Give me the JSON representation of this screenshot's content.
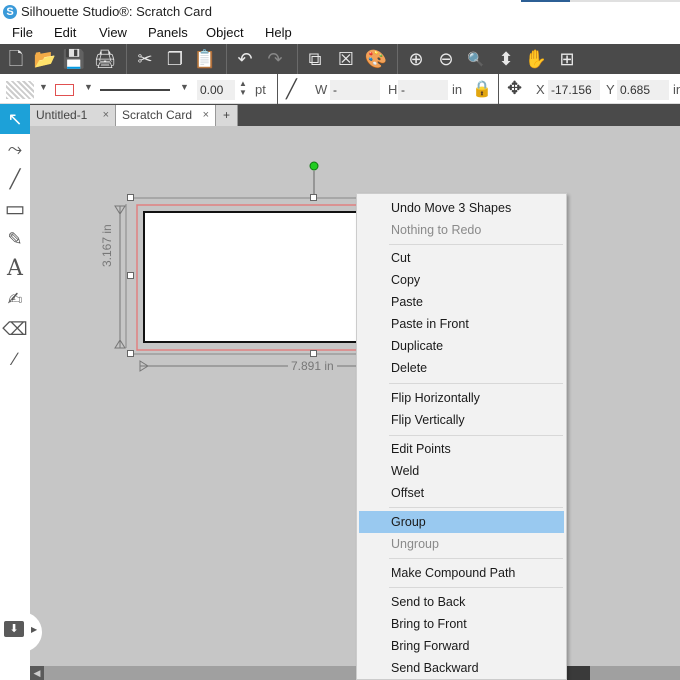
{
  "window": {
    "title": "Silhouette Studio®: Scratch Card",
    "logo_glyph": "S"
  },
  "menubar": {
    "items": [
      {
        "label": "File"
      },
      {
        "label": "Edit"
      },
      {
        "label": "View"
      },
      {
        "label": "Panels"
      },
      {
        "label": "Object"
      },
      {
        "label": "Help"
      }
    ]
  },
  "toolbar_main": {
    "icons": [
      {
        "name": "new-document-icon",
        "glyph": "🗋"
      },
      {
        "name": "open-folder-icon",
        "glyph": "📂"
      },
      {
        "name": "save-icon",
        "glyph": "💾"
      },
      {
        "name": "print-icon",
        "glyph": "🖨"
      },
      {
        "name": "cut-icon",
        "glyph": "✂"
      },
      {
        "name": "copy-icon",
        "glyph": "❐"
      },
      {
        "name": "paste-icon",
        "glyph": "📋"
      },
      {
        "name": "undo-icon",
        "glyph": "↶"
      },
      {
        "name": "redo-icon",
        "glyph": "↷"
      },
      {
        "name": "group-icon",
        "glyph": "⧉"
      },
      {
        "name": "ungroup-icon",
        "glyph": "☒"
      },
      {
        "name": "fill-color-icon",
        "glyph": "🎨"
      },
      {
        "name": "zoom-in-icon",
        "glyph": "⊕"
      },
      {
        "name": "zoom-out-icon",
        "glyph": "⊖"
      },
      {
        "name": "zoom-selection-icon",
        "glyph": "🔍"
      },
      {
        "name": "pan-drag-icon",
        "glyph": "⬍"
      },
      {
        "name": "hand-icon",
        "glyph": "✋"
      },
      {
        "name": "fit-to-page-icon",
        "glyph": "⊞"
      }
    ]
  },
  "toolbar_props": {
    "line_width_value": "0.00",
    "line_width_unit": "pt",
    "w_label": "W",
    "w_value": "-",
    "h_label": "H",
    "h_value": "-",
    "size_unit": "in",
    "x_label": "X",
    "x_value": "-17.156",
    "y_label": "Y",
    "y_value": "0.685",
    "pos_unit": "in",
    "stroke_color": "#e05050"
  },
  "tabs": [
    {
      "label": "Untitled-1",
      "close": "×",
      "active": false
    },
    {
      "label": "Scratch Card",
      "close": "×",
      "active": true
    }
  ],
  "new_tab_label": "+",
  "tools": [
    {
      "name": "select-tool-icon",
      "glyph": "↖"
    },
    {
      "name": "bezier-tool-icon",
      "glyph": "⤳"
    },
    {
      "name": "line-tool-icon",
      "glyph": "╱"
    },
    {
      "name": "rectangle-tool-icon",
      "glyph": "▭"
    },
    {
      "name": "pencil-tool-icon",
      "glyph": "✎"
    },
    {
      "name": "text-tool-icon",
      "glyph": "A"
    },
    {
      "name": "sketch-tool-icon",
      "glyph": "✍"
    },
    {
      "name": "eraser-tool-icon",
      "glyph": "⌫"
    },
    {
      "name": "knife-tool-icon",
      "glyph": "∕"
    }
  ],
  "canvas": {
    "height_dim": "3.167 in",
    "width_dim": "7.891 in",
    "rotate_handle_color": "#22cc22",
    "cut_line_color": "#e08080"
  },
  "context_menu": {
    "items": [
      {
        "label": "Undo Move 3 Shapes",
        "disabled": false
      },
      {
        "label": "Nothing to Redo",
        "disabled": true
      },
      {
        "sep": true
      },
      {
        "label": "Cut",
        "disabled": false
      },
      {
        "label": "Copy",
        "disabled": false
      },
      {
        "label": "Paste",
        "disabled": false
      },
      {
        "label": "Paste in Front",
        "disabled": false
      },
      {
        "label": "Duplicate",
        "disabled": false
      },
      {
        "label": "Delete",
        "disabled": false
      },
      {
        "sep": true
      },
      {
        "label": "Flip Horizontally",
        "disabled": false
      },
      {
        "label": "Flip Vertically",
        "disabled": false
      },
      {
        "sep": true
      },
      {
        "label": "Edit Points",
        "disabled": false
      },
      {
        "label": "Weld",
        "disabled": false
      },
      {
        "label": "Offset",
        "disabled": false
      },
      {
        "sep": true
      },
      {
        "label": "Group",
        "disabled": false,
        "highlighted": true
      },
      {
        "label": "Ungroup",
        "disabled": true
      },
      {
        "sep": true
      },
      {
        "label": "Make Compound Path",
        "disabled": false
      },
      {
        "sep": true
      },
      {
        "label": "Send to Back",
        "disabled": false
      },
      {
        "label": "Bring to Front",
        "disabled": false
      },
      {
        "label": "Bring Forward",
        "disabled": false
      },
      {
        "label": "Send Backward",
        "disabled": false
      }
    ],
    "highlight_color": "#99c9f0"
  }
}
